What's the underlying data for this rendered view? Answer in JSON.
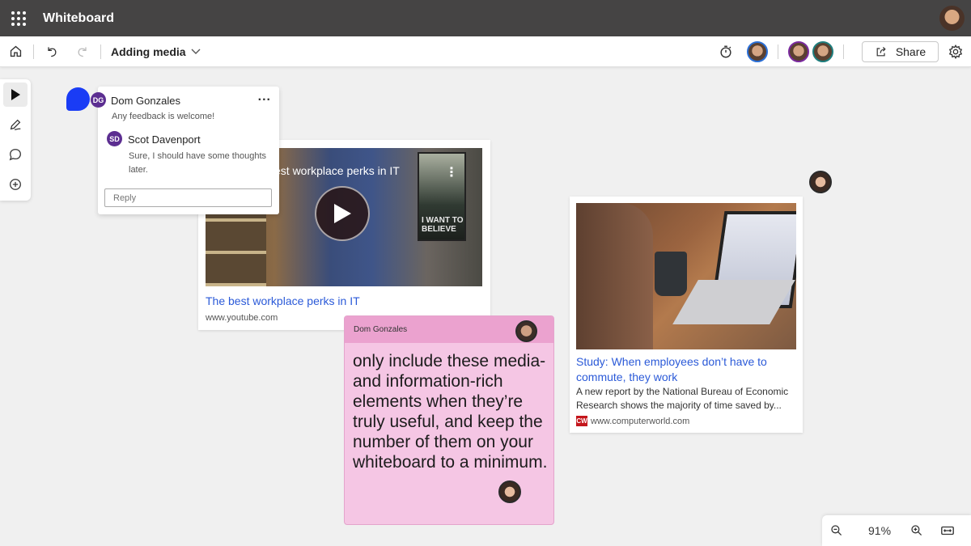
{
  "app": {
    "title": "Whiteboard"
  },
  "toolbar": {
    "board_name": "Adding media",
    "share_label": "Share",
    "collaborators": [
      {
        "ring_color": "#2a6fd6"
      },
      {
        "ring_color": "#7a2a9e"
      },
      {
        "ring_color": "#1e7d7d"
      }
    ]
  },
  "left_rail": {
    "tools": [
      "select",
      "pen",
      "comment",
      "add"
    ]
  },
  "comment_thread": {
    "author_initials": "DG",
    "author": "Dom Gonzales",
    "message": "Any feedback is welcome!",
    "reply_initials": "SD",
    "reply_author": "Scot Davenport",
    "reply_message_line1": "Sure, I should have some thoughts",
    "reply_message_line2": "later.",
    "reply_placeholder": "Reply",
    "more_label": "..."
  },
  "video_card": {
    "overlay_title": "est workplace perks in IT",
    "poster_text": "I WANT TO BELIEVE",
    "title": "The best workplace perks in IT",
    "source": "www.youtube.com"
  },
  "article_card": {
    "title": "Study: When employees don’t have to commute, they work",
    "description": "A new report by the National Bureau of Economic Research shows the majority of time saved by...",
    "source_logo": "CW",
    "source": "www.computerworld.com"
  },
  "sticky_note": {
    "author": "Dom Gonzales",
    "text": "only include these media- and information-rich elements when they’re truly useful, and keep the number of them on your whiteboard to a minimum.",
    "color": "#f5c6e4"
  },
  "zoom": {
    "level": "91%"
  }
}
